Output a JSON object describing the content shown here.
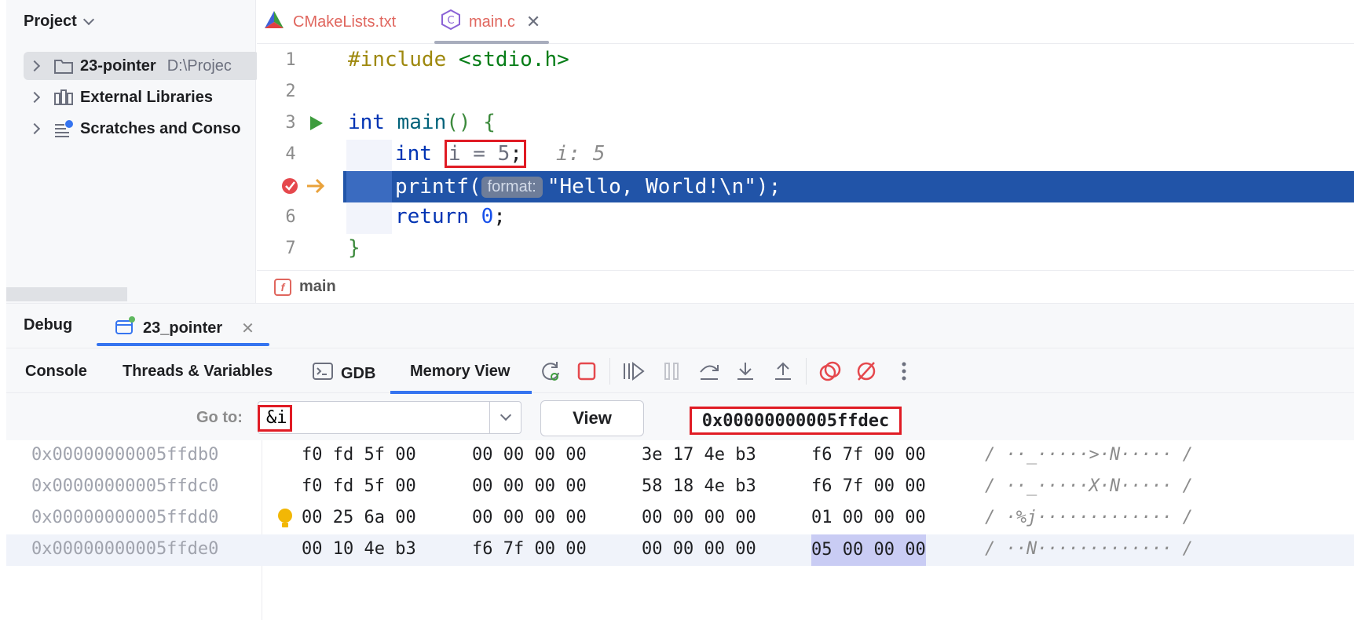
{
  "project": {
    "title": "Project",
    "items": [
      {
        "label": "23-pointer",
        "path": "D:\\Projec"
      },
      {
        "label": "External Libraries"
      },
      {
        "label": "Scratches and Conso"
      }
    ]
  },
  "editor": {
    "tabs": [
      {
        "label": "CMakeLists.txt"
      },
      {
        "label": "main.c"
      }
    ],
    "line_numbers": [
      "1",
      "2",
      "3",
      "4",
      "6",
      "7"
    ],
    "code": {
      "l1_directive": "#include",
      "l1_header": " <stdio.h>",
      "l3_kw": "int",
      "l3_fn": " main",
      "l3_parens": "()",
      "l3_brace": " {",
      "l4_kw": "int",
      "l4_body": "i = 5",
      "l4_semi": ";",
      "l4_hint": "i: 5",
      "l5_fn": "printf(",
      "l5_param": "format:",
      "l5_str": "\"Hello, World!\\n\");",
      "l6_kw": "return",
      "l6_num": " 0",
      "l6_semi": ";",
      "l7_brace": "}"
    },
    "breadcrumb": "main"
  },
  "debug": {
    "tab_debug": "Debug",
    "tab_session": "23_pointer",
    "subtabs": [
      "Console",
      "Threads & Variables",
      "GDB",
      "Memory View"
    ],
    "goto_label": "Go to:",
    "goto_value": "&i",
    "view_label": "View",
    "address": "0x00000000005ffdec",
    "rows": [
      {
        "addr": "0x00000000005ffdb0",
        "g1": "f0 fd 5f 00",
        "g2": "00 00 00 00",
        "g3": "3e 17 4e b3",
        "g4": "f6 7f 00 00",
        "ascii": "··_·····>·N·····"
      },
      {
        "addr": "0x00000000005ffdc0",
        "g1": "f0 fd 5f 00",
        "g2": "00 00 00 00",
        "g3": "58 18 4e b3",
        "g4": "f6 7f 00 00",
        "ascii": "··_·····X·N·····"
      },
      {
        "addr": "0x00000000005ffdd0",
        "g1": "00 25 6a 00",
        "g2": "00 00 00 00",
        "g3": "00 00 00 00",
        "g4": "01 00 00 00",
        "ascii": "·%j·············"
      },
      {
        "addr": "0x00000000005ffde0",
        "g1": "00 10 4e b3",
        "g2": "f6 7f 00 00",
        "g3": "00 00 00 00",
        "g4": "05 00 00 00",
        "ascii": "··N·············"
      }
    ]
  },
  "colors": {
    "exec_line": "#2154a8",
    "highlight_box": "#e01b24",
    "accent": "#3574f0"
  }
}
